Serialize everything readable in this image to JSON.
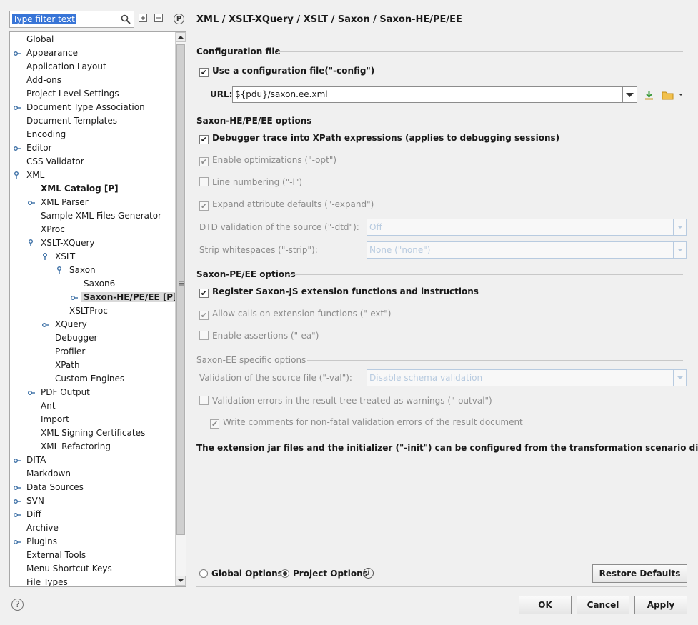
{
  "filter": {
    "placeholder": "Type filter text"
  },
  "toolbar": {
    "p_label": "P"
  },
  "tree": {
    "items": [
      {
        "label": "Global",
        "depth": 0,
        "toggle": "",
        "bold": false
      },
      {
        "label": "Appearance",
        "depth": 0,
        "toggle": "collapsed",
        "bold": false
      },
      {
        "label": "Application Layout",
        "depth": 0,
        "toggle": "",
        "bold": false
      },
      {
        "label": "Add-ons",
        "depth": 0,
        "toggle": "",
        "bold": false
      },
      {
        "label": "Project Level Settings",
        "depth": 0,
        "toggle": "",
        "bold": false
      },
      {
        "label": "Document Type Association",
        "depth": 0,
        "toggle": "collapsed",
        "bold": false
      },
      {
        "label": "Document Templates",
        "depth": 0,
        "toggle": "",
        "bold": false
      },
      {
        "label": "Encoding",
        "depth": 0,
        "toggle": "",
        "bold": false
      },
      {
        "label": "Editor",
        "depth": 0,
        "toggle": "collapsed",
        "bold": false
      },
      {
        "label": "CSS Validator",
        "depth": 0,
        "toggle": "",
        "bold": false
      },
      {
        "label": "XML",
        "depth": 0,
        "toggle": "expanded",
        "bold": false
      },
      {
        "label": "XML Catalog [P]",
        "depth": 1,
        "toggle": "",
        "bold": true
      },
      {
        "label": "XML Parser",
        "depth": 1,
        "toggle": "collapsed",
        "bold": false
      },
      {
        "label": "Sample XML Files Generator",
        "depth": 1,
        "toggle": "",
        "bold": false
      },
      {
        "label": "XProc",
        "depth": 1,
        "toggle": "",
        "bold": false
      },
      {
        "label": "XSLT-XQuery",
        "depth": 1,
        "toggle": "expanded",
        "bold": false
      },
      {
        "label": "XSLT",
        "depth": 2,
        "toggle": "expanded",
        "bold": false
      },
      {
        "label": "Saxon",
        "depth": 3,
        "toggle": "expanded",
        "bold": false
      },
      {
        "label": "Saxon6",
        "depth": 4,
        "toggle": "",
        "bold": false
      },
      {
        "label": "Saxon-HE/PE/EE [P]",
        "depth": 4,
        "toggle": "collapsed",
        "bold": true,
        "selected": true
      },
      {
        "label": "XSLTProc",
        "depth": 3,
        "toggle": "",
        "bold": false
      },
      {
        "label": "XQuery",
        "depth": 2,
        "toggle": "collapsed",
        "bold": false
      },
      {
        "label": "Debugger",
        "depth": 2,
        "toggle": "",
        "bold": false
      },
      {
        "label": "Profiler",
        "depth": 2,
        "toggle": "",
        "bold": false
      },
      {
        "label": "XPath",
        "depth": 2,
        "toggle": "",
        "bold": false
      },
      {
        "label": "Custom Engines",
        "depth": 2,
        "toggle": "",
        "bold": false
      },
      {
        "label": "PDF Output",
        "depth": 1,
        "toggle": "collapsed",
        "bold": false
      },
      {
        "label": "Ant",
        "depth": 1,
        "toggle": "",
        "bold": false
      },
      {
        "label": "Import",
        "depth": 1,
        "toggle": "",
        "bold": false
      },
      {
        "label": "XML Signing Certificates",
        "depth": 1,
        "toggle": "",
        "bold": false
      },
      {
        "label": "XML Refactoring",
        "depth": 1,
        "toggle": "",
        "bold": false
      },
      {
        "label": "DITA",
        "depth": 0,
        "toggle": "collapsed",
        "bold": false
      },
      {
        "label": "Markdown",
        "depth": 0,
        "toggle": "",
        "bold": false
      },
      {
        "label": "Data Sources",
        "depth": 0,
        "toggle": "collapsed",
        "bold": false
      },
      {
        "label": "SVN",
        "depth": 0,
        "toggle": "collapsed",
        "bold": false
      },
      {
        "label": "Diff",
        "depth": 0,
        "toggle": "collapsed",
        "bold": false
      },
      {
        "label": "Archive",
        "depth": 0,
        "toggle": "",
        "bold": false
      },
      {
        "label": "Plugins",
        "depth": 0,
        "toggle": "collapsed",
        "bold": false
      },
      {
        "label": "External Tools",
        "depth": 0,
        "toggle": "",
        "bold": false
      },
      {
        "label": "Menu Shortcut Keys",
        "depth": 0,
        "toggle": "",
        "bold": false
      },
      {
        "label": "File Types",
        "depth": 0,
        "toggle": "",
        "bold": false
      }
    ]
  },
  "page": {
    "title": "XML / XSLT-XQuery / XSLT / Saxon / Saxon-HE/PE/EE"
  },
  "config": {
    "header": "Configuration file",
    "use_config_label": "Use a configuration file(\"-config\")",
    "use_config_checked": true,
    "url_label": "URL:",
    "url_value": "${pdu}/saxon.ee.xml"
  },
  "heopts": {
    "header": "Saxon-HE/PE/EE options",
    "debugger_trace": "Debugger trace into XPath expressions (applies to debugging sessions)",
    "enable_opt": "Enable optimizations (\"-opt\")",
    "line_numbering": "Line numbering (\"-l\")",
    "expand_attr": "Expand attribute defaults (\"-expand\")",
    "dtd_label": "DTD validation of the source (\"-dtd\"):",
    "dtd_value": "Off",
    "strip_label": "Strip whitespaces (\"-strip\"):",
    "strip_value": "None (\"none\")"
  },
  "peopts": {
    "header": "Saxon-PE/EE options",
    "register_js": "Register Saxon-JS extension functions and instructions",
    "allow_ext": "Allow calls on extension functions (\"-ext\")",
    "enable_assert": "Enable assertions (\"-ea\")"
  },
  "eeopts": {
    "header": "Saxon-EE specific options",
    "val_label": "Validation of the source file (\"-val\"):",
    "val_value": "Disable schema validation",
    "outval": "Validation errors in the result tree treated as warnings (\"-outval\")",
    "write_comments": "Write comments for non-fatal validation errors of the result document"
  },
  "note": "The extension jar files and the initializer (\"-init\") can be configured from the transformation scenario dialog.",
  "options_scope": {
    "global_label": "Global Options",
    "project_label": "Project Options",
    "selected": "project"
  },
  "buttons": {
    "restore": "Restore Defaults",
    "ok": "OK",
    "cancel": "Cancel",
    "apply": "Apply"
  },
  "colors": {
    "selection": "#3875d7",
    "disabled_text": "#8c8c8c",
    "disabled_combo": "#b8cbe0",
    "folder_icon": "#e8b12a",
    "download_icon": "#3c9b3c"
  }
}
